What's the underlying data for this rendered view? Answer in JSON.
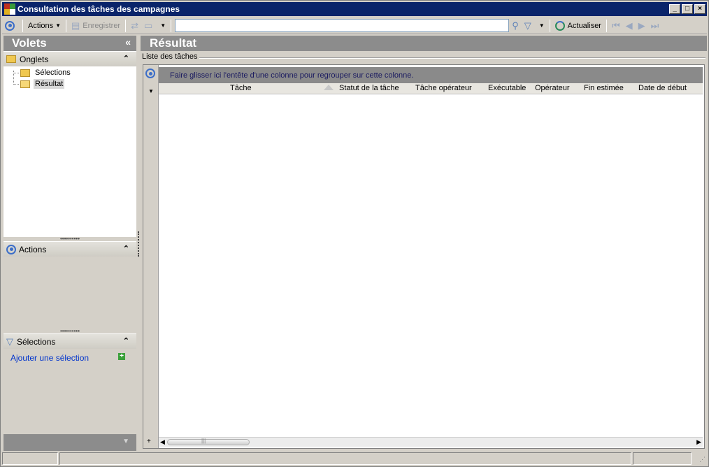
{
  "window": {
    "title": "Consultation des tâches des campagnes",
    "controls": {
      "minimize": "_",
      "maximize": "□",
      "close": "×"
    }
  },
  "toolbar": {
    "actions_label": "Actions",
    "save_label": "Enregistrer",
    "search_value": "",
    "refresh_label": "Actualiser"
  },
  "left": {
    "header": "Volets",
    "collapse_glyph": "«",
    "onglets": {
      "title": "Onglets",
      "items": [
        {
          "label": "Sélections"
        },
        {
          "label": "Résultat"
        }
      ]
    },
    "actions": {
      "title": "Actions"
    },
    "selections": {
      "title": "Sélections",
      "add_link": "Ajouter une sélection"
    }
  },
  "main": {
    "header": "Résultat",
    "group_title": "Liste des tâches",
    "group_bar_hint": "Faire glisser ici l'entête d'une colonne pour regrouper sur cette colonne.",
    "columns": [
      "Tâche",
      "Statut de la tâche",
      "Tâche opérateur",
      "Exécutable",
      "Opérateur",
      "Fin estimée",
      "Date de début"
    ],
    "rows": []
  },
  "icons": {
    "accent": "#3c6ec8",
    "header_gray": "#8c8c8c",
    "title_bar": "#0a246a"
  }
}
